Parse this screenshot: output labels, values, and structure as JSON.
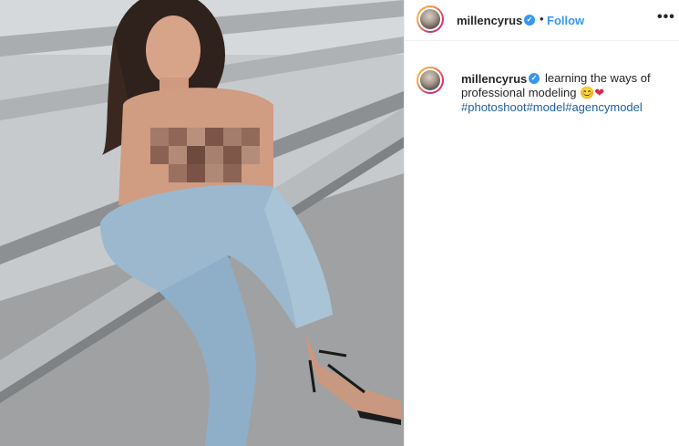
{
  "post": {
    "image_alt": "photo-of-model-sitting-on-rooftop-ledge"
  },
  "header": {
    "username": "millencyrus",
    "separator": "•",
    "follow_label": "Follow",
    "more_label": "•••"
  },
  "caption": {
    "username": "millencyrus",
    "text": "learning the ways of professional modeling",
    "emoji": "😊",
    "heart": "❤",
    "hashtags": [
      "#photoshoot",
      "#model",
      "#agencymodel"
    ]
  },
  "colors": {
    "link": "#3897f0",
    "hashtag": "#1e5f9e",
    "text": "#262626",
    "divider": "#efefef"
  },
  "icons": {
    "verified": "verified-badge-icon",
    "more": "more-options-icon"
  }
}
